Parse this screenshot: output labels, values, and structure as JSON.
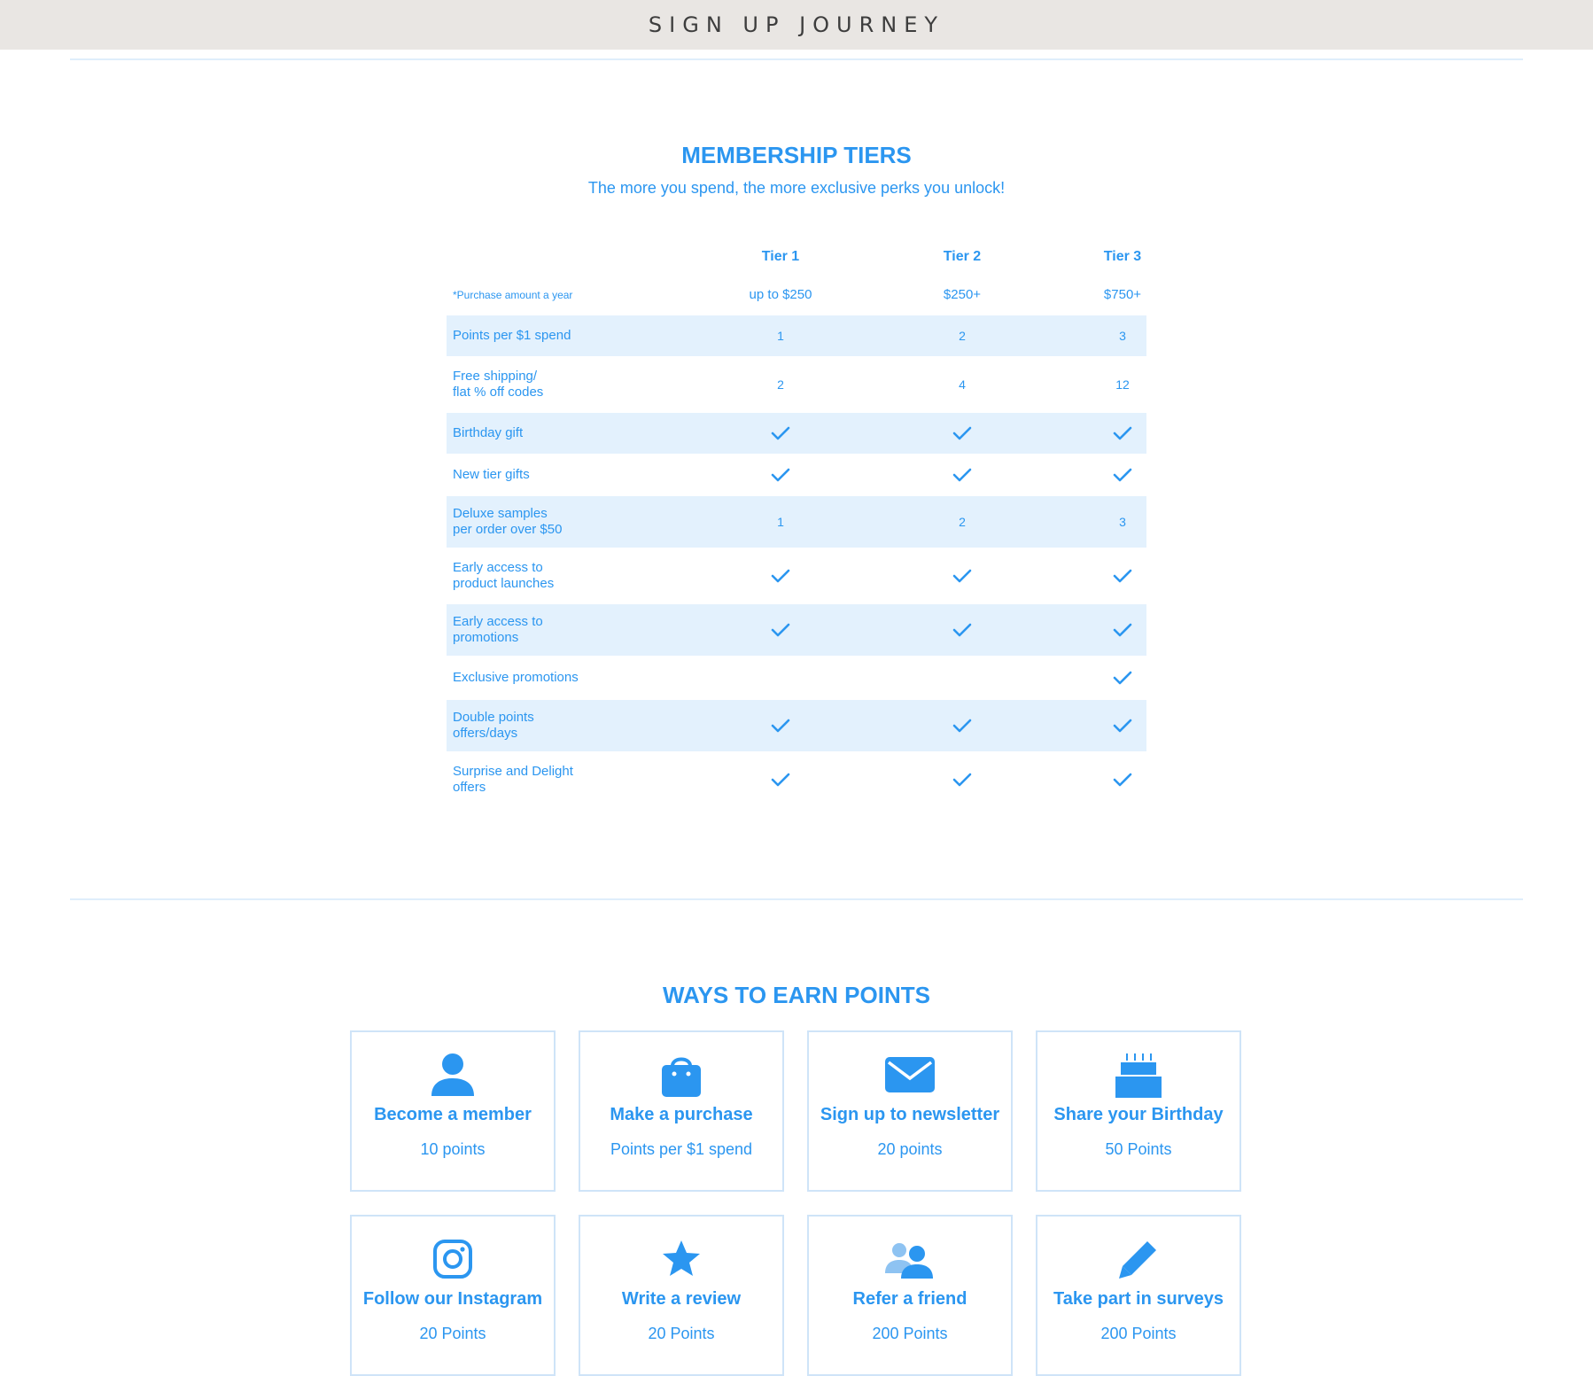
{
  "banner": {
    "title": "SIGN UP JOURNEY"
  },
  "tiers": {
    "title": "MEMBERSHIP TIERS",
    "subtitle": "The more you spend, the more exclusive perks you unlock!",
    "columns": [
      "Tier 1",
      "Tier 2",
      "Tier 3"
    ],
    "amount_label": "*Purchase amount a year",
    "amounts": [
      "up to $250",
      "$250+",
      "$750+"
    ],
    "rows": [
      {
        "label": "Points per $1 spend",
        "values": [
          "1",
          "2",
          "3"
        ]
      },
      {
        "label": "Free shipping/\nflat % off codes",
        "values": [
          "2",
          "4",
          "12"
        ]
      },
      {
        "label": "Birthday gift",
        "values": [
          true,
          true,
          true
        ]
      },
      {
        "label": "New tier gifts",
        "values": [
          true,
          true,
          true
        ]
      },
      {
        "label": "Deluxe samples\nper order over $50",
        "values": [
          "1",
          "2",
          "3"
        ]
      },
      {
        "label": "Early access to\nproduct launches",
        "values": [
          true,
          true,
          true
        ]
      },
      {
        "label": "Early access to\npromotions",
        "values": [
          true,
          true,
          true
        ]
      },
      {
        "label": "Exclusive promotions",
        "values": [
          false,
          false,
          true
        ]
      },
      {
        "label": "Double points\noffers/days",
        "values": [
          true,
          true,
          true
        ]
      },
      {
        "label": "Surprise and Delight\noffers",
        "values": [
          true,
          true,
          true
        ]
      }
    ]
  },
  "earn": {
    "title": "WAYS TO EARN POINTS",
    "cards": [
      {
        "title": "Become a member",
        "points": "10 points",
        "icon": "person-icon"
      },
      {
        "title": "Make a purchase",
        "points": "Points per $1 spend",
        "icon": "shopping-bag-icon"
      },
      {
        "title": "Sign up to newsletter",
        "points": "20 points",
        "icon": "envelope-icon"
      },
      {
        "title": "Share your Birthday",
        "points": "50 Points",
        "icon": "birthday-cake-icon"
      },
      {
        "title": "Follow our Instagram",
        "points": "20 Points",
        "icon": "instagram-icon"
      },
      {
        "title": "Write a review",
        "points": "20 Points",
        "icon": "star-icon"
      },
      {
        "title": "Refer a friend",
        "points": "200 Points",
        "icon": "people-icon"
      },
      {
        "title": "Take part in surveys",
        "points": "200 Points",
        "icon": "pencil-icon"
      }
    ]
  },
  "colors": {
    "accent": "#2b96f0",
    "row_shade": "#e3f1fd",
    "banner_bg": "#e9e6e3"
  }
}
